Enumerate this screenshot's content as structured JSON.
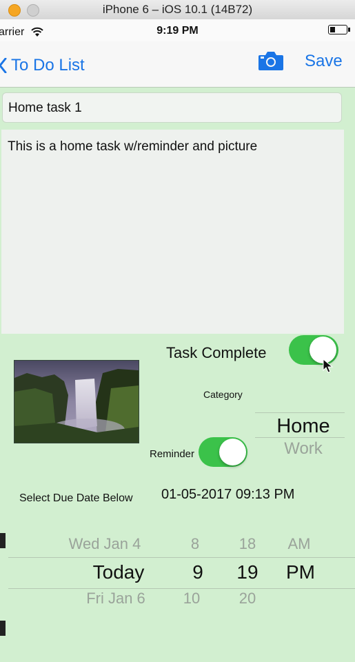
{
  "simulator": {
    "title": "iPhone 6 – iOS 10.1 (14B72)"
  },
  "status_bar": {
    "carrier": "arrier",
    "time": "9:19 PM"
  },
  "nav": {
    "back_label": "To Do List",
    "save_label": "Save",
    "camera_icon": "camera-icon"
  },
  "task": {
    "title": "Home task 1",
    "notes": "This is a home task w/reminder and picture",
    "complete_label": "Task Complete",
    "complete_on": true,
    "category_label": "Category",
    "category_options": [
      "Home",
      "Work"
    ],
    "category_selected": "Home",
    "reminder_label": "Reminder",
    "reminder_on": true,
    "due_label": "Select Due Date Below",
    "due_value": "01-05-2017 09:13 PM"
  },
  "date_picker": {
    "days": [
      "Wed Jan 4",
      "Today",
      "Fri Jan 6"
    ],
    "hours": [
      "8",
      "9",
      "10"
    ],
    "minutes": [
      "18",
      "19",
      "20"
    ],
    "ampm": [
      "AM",
      "PM"
    ]
  },
  "colors": {
    "background": "#d2efd0",
    "accent": "#1a75e6",
    "toggle_on": "#3bc24a"
  }
}
